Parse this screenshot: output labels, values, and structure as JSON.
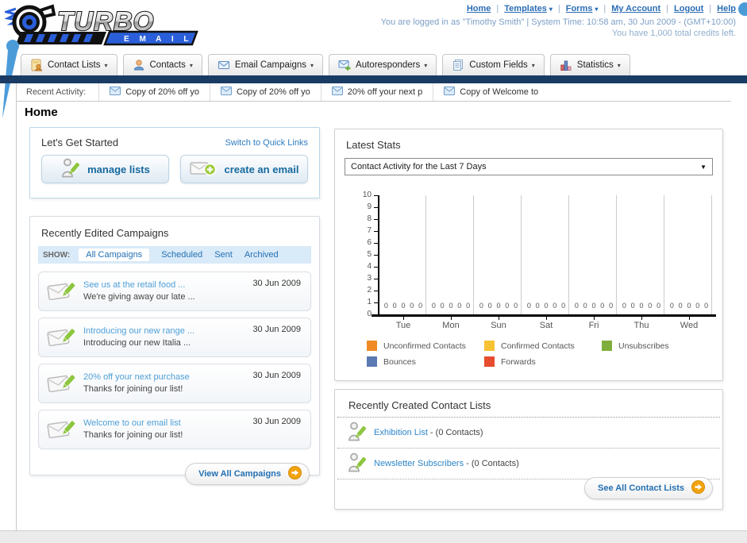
{
  "brand": {
    "name": "TURBO",
    "sub": "E M A I L"
  },
  "header": {
    "links": [
      {
        "label": "Home",
        "caret": false
      },
      {
        "label": "Templates",
        "caret": true
      },
      {
        "label": "Forms",
        "caret": true
      },
      {
        "label": "My Account",
        "caret": false
      },
      {
        "label": "Logout",
        "caret": false
      },
      {
        "label": "Help",
        "caret": false
      }
    ],
    "login_line": "You are logged in as \"Timothy Smith\" | System Time: 10:58 am, 30 Jun 2009 - (GMT+10:00)",
    "credits_line": "You have 1,000 total credits left."
  },
  "nav": {
    "tabs": [
      {
        "label": "Contact Lists",
        "icon": "contact-lists-icon"
      },
      {
        "label": "Contacts",
        "icon": "contacts-icon"
      },
      {
        "label": "Email Campaigns",
        "icon": "email-campaigns-icon"
      },
      {
        "label": "Autoresponders",
        "icon": "autoresponders-icon"
      },
      {
        "label": "Custom Fields",
        "icon": "custom-fields-icon"
      },
      {
        "label": "Statistics",
        "icon": "statistics-icon"
      }
    ]
  },
  "recent_activity": {
    "label": "Recent Activity:",
    "items": [
      "Copy of 20% off yo",
      "Copy of 20% off yo",
      "20% off your next p",
      "Copy of Welcome to"
    ]
  },
  "page": {
    "title": "Home"
  },
  "get_started": {
    "title": "Let's Get Started",
    "switch_link": "Switch to Quick Links",
    "buttons": [
      {
        "label": "manage lists",
        "icon": "person-pencil-icon"
      },
      {
        "label": "create an email",
        "icon": "envelope-plus-icon"
      }
    ]
  },
  "campaigns": {
    "title": "Recently Edited Campaigns",
    "show_label": "SHOW:",
    "filters": [
      {
        "label": "All Campaigns",
        "active": true
      },
      {
        "label": "Scheduled",
        "active": false
      },
      {
        "label": "Sent",
        "active": false
      },
      {
        "label": "Archived",
        "active": false
      }
    ],
    "items": [
      {
        "title": "See us at the retail food ...",
        "subtitle": "We're giving away our late ...",
        "date": "30 Jun 2009"
      },
      {
        "title": "Introducing our new range ...",
        "subtitle": "Introducing our new Italia ...",
        "date": "30 Jun 2009"
      },
      {
        "title": "20% off your next purchase",
        "subtitle": "Thanks for joining our list!",
        "date": "30 Jun 2009"
      },
      {
        "title": "Welcome to our email list",
        "subtitle": "Thanks for joining our list!",
        "date": "30 Jun 2009"
      }
    ],
    "view_all_label": "View All Campaigns"
  },
  "stats": {
    "title": "Latest Stats",
    "selected_option": "Contact Activity for the Last 7 Days"
  },
  "chart_data": {
    "type": "bar",
    "title": "Contact Activity for the Last 7 Days",
    "categories": [
      "Tue",
      "Mon",
      "Sun",
      "Sat",
      "Fri",
      "Thu",
      "Wed"
    ],
    "series": [
      {
        "name": "Unconfirmed Contacts",
        "color": "#F08A24",
        "values": [
          0,
          0,
          0,
          0,
          0,
          0,
          0
        ]
      },
      {
        "name": "Confirmed Contacts",
        "color": "#F6C231",
        "values": [
          0,
          0,
          0,
          0,
          0,
          0,
          0
        ]
      },
      {
        "name": "Unsubscribes",
        "color": "#7FAE3A",
        "values": [
          0,
          0,
          0,
          0,
          0,
          0,
          0
        ]
      },
      {
        "name": "Bounces",
        "color": "#5B79B2",
        "values": [
          0,
          0,
          0,
          0,
          0,
          0,
          0
        ]
      },
      {
        "name": "Forwards",
        "color": "#E64C2E",
        "values": [
          0,
          0,
          0,
          0,
          0,
          0,
          0
        ]
      }
    ],
    "ylim": [
      0,
      10
    ],
    "yticks": [
      0,
      1,
      2,
      3,
      4,
      5,
      6,
      7,
      8,
      9,
      10
    ],
    "grid": "vertical group separators",
    "legend_position": "bottom",
    "value_labels": "each series value (0) printed above x-axis per day group"
  },
  "contact_lists": {
    "title": "Recently Created Contact Lists",
    "items": [
      {
        "name": "Exhibition List",
        "detail": "- (0 Contacts)"
      },
      {
        "name": "Newsletter Subscribers",
        "detail": "- (0 Contacts)"
      }
    ],
    "see_all_label": "See All Contact Lists"
  },
  "colors": {
    "navy_bar": "#1A3C64",
    "link_blue": "#2B6DB4",
    "light_link_blue": "#4FA0D8",
    "button_text_blue": "#17699E",
    "filter_bar_bg": "#D9EAF8",
    "orange_arrow": "#F2A30F",
    "decor_dot_blue": "#4C9BD9"
  }
}
